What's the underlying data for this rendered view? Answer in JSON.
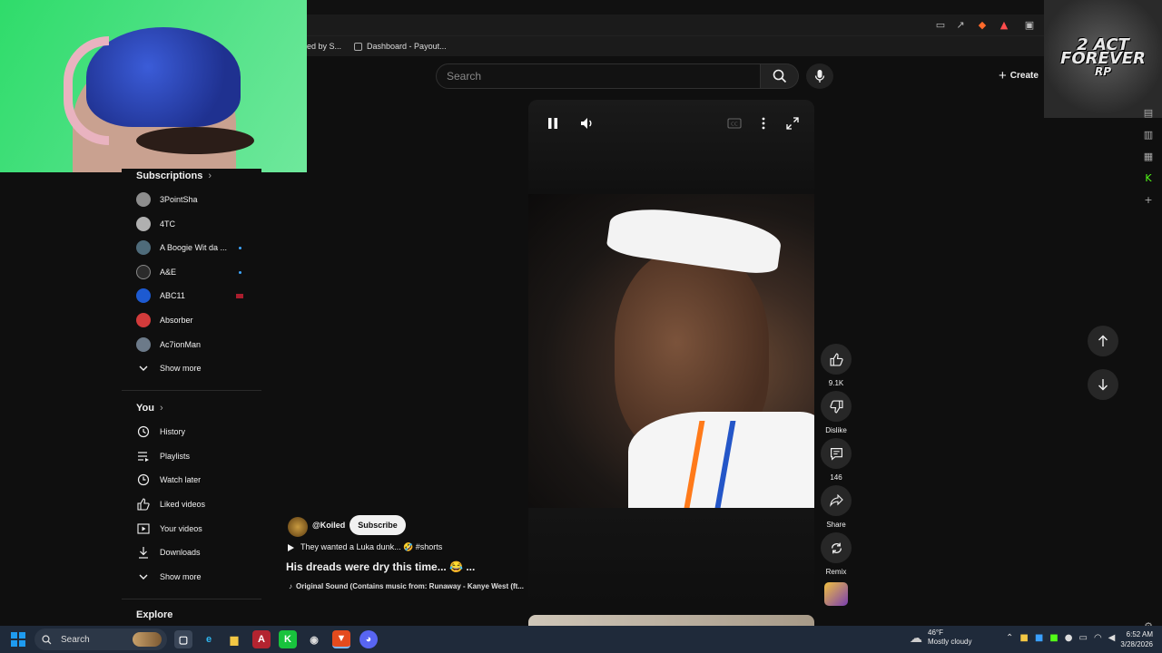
{
  "browser": {
    "bookmarks": [
      {
        "label": "ed by S..."
      },
      {
        "label": "Dashboard - Payout..."
      }
    ]
  },
  "overlay": {
    "logo_text_line1": "2 ACT",
    "logo_text_line2": "FOREVER",
    "logo_text_line3": "RP"
  },
  "header": {
    "search_placeholder": "Search",
    "create_label": "Create"
  },
  "sidebar": {
    "subscriptions_title": "Subscriptions",
    "subscriptions": [
      {
        "label": "3PointSha",
        "color": "#8d8d8d"
      },
      {
        "label": "4TC",
        "color": "#b0b0b0"
      },
      {
        "label": "A Boogie Wit da ...",
        "color": "#4e6b7a"
      },
      {
        "label": "A&E",
        "color": "#2b2b2b"
      },
      {
        "label": "ABC11",
        "color": "#1d5ad1"
      },
      {
        "label": "Absorber",
        "color": "#d23b3b"
      },
      {
        "label": "Ac7ionMan",
        "color": "#6c7a89"
      }
    ],
    "show_more_1": "Show more",
    "you_title": "You",
    "you_items": [
      {
        "label": "History",
        "icon": "history-icon"
      },
      {
        "label": "Playlists",
        "icon": "playlists-icon"
      },
      {
        "label": "Watch later",
        "icon": "watch-later-icon"
      },
      {
        "label": "Liked videos",
        "icon": "liked-icon"
      },
      {
        "label": "Your videos",
        "icon": "your-videos-icon"
      },
      {
        "label": "Downloads",
        "icon": "downloads-icon"
      }
    ],
    "show_more_2": "Show more",
    "explore_title": "Explore"
  },
  "short": {
    "channel_handle": "@Koiled",
    "subscribe_label": "Subscribe",
    "playlist_text": "They wanted a Luka dunk... 🤣 #shorts",
    "title": "His dreads were dry this time... 😂 ...",
    "sound": "Original Sound (Contains music from: Runaway - Kanye West (ft..."
  },
  "actions": {
    "likes": "9.1K",
    "dislike": "Dislike",
    "comments": "146",
    "share": "Share",
    "remix": "Remix"
  },
  "taskbar": {
    "search_label": "Search",
    "weather_temp": "46°F",
    "weather_desc": "Mostly cloudy",
    "time": "6:52 AM",
    "date": "3/28/2026"
  },
  "colors": {
    "accent_blue": "#3ea6ff",
    "subscribe_bg": "#f1f1f1",
    "page_bg": "#0f0f0f"
  }
}
